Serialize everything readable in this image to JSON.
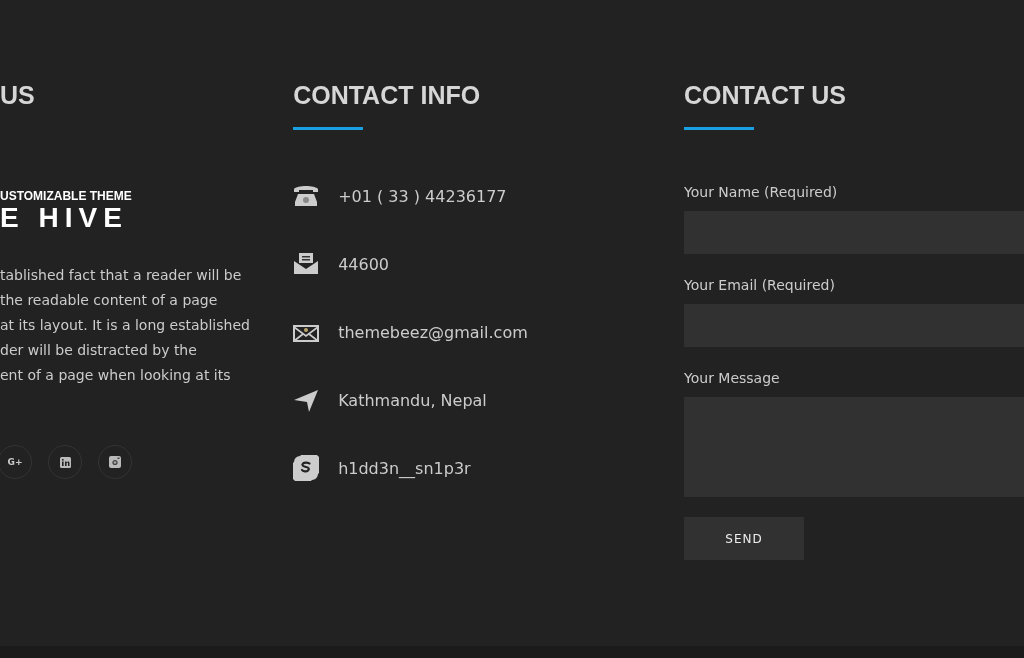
{
  "about": {
    "heading": "US",
    "tagline": "USTOMIZABLE THEME",
    "logo": "E HIVE",
    "text_lines": [
      "tablished fact that a reader will be",
      "the readable content of a page",
      "at its layout. It is a long established",
      "der will be distracted by the",
      "ent of a page when looking at its"
    ],
    "social": [
      {
        "kind": "googleplus",
        "label": "G+"
      },
      {
        "kind": "linkedin"
      },
      {
        "kind": "instagram"
      }
    ]
  },
  "contact_info": {
    "heading": "CONTACT INFO",
    "items": [
      {
        "kind": "phone",
        "text": "+01 ( 33 ) 44236177"
      },
      {
        "kind": "mail",
        "text": "44600"
      },
      {
        "kind": "email",
        "text": "themebeez@gmail.com"
      },
      {
        "kind": "location",
        "text": "Kathmandu, Nepal"
      },
      {
        "kind": "skype",
        "text": "h1dd3n__sn1p3r"
      }
    ]
  },
  "contact_form": {
    "heading": "CONTACT US",
    "fields": [
      {
        "kind": "text",
        "label": "Your Name (Required)"
      },
      {
        "kind": "text",
        "label": "Your Email (Required)"
      },
      {
        "kind": "textarea",
        "label": "Your Message"
      }
    ],
    "button": "SEND"
  }
}
